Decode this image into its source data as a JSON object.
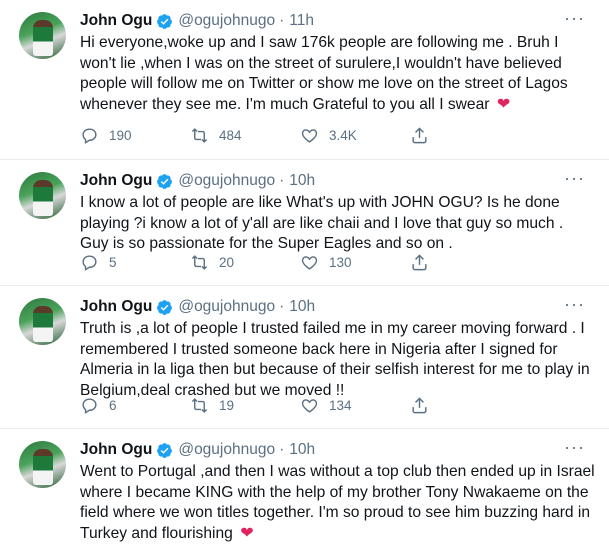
{
  "tweets": [
    {
      "author": "John Ogu",
      "handle": "@ogujohnugo",
      "separator": "·",
      "time": "11h",
      "text": "Hi everyone,woke up and I saw 176k people are following me . Bruh I won't lie ,when I was on the street of surulere,I wouldn't have believed people will follow me on Twitter or show me love on the street of Lagos whenever they see me. I'm much Grateful to you all I swear",
      "emoji": "❤",
      "replies": "190",
      "retweets": "484",
      "likes": "3.4K"
    },
    {
      "author": "John Ogu",
      "handle": "@ogujohnugo",
      "separator": "·",
      "time": "10h",
      "text": "I know a lot of people are like What's up with JOHN OGU? Is he done playing ?i know a lot of y'all are like chaii and I love that guy so much . Guy is so passionate for the Super Eagles and so on .",
      "emoji": "",
      "replies": "5",
      "retweets": "20",
      "likes": "130"
    },
    {
      "author": "John Ogu",
      "handle": "@ogujohnugo",
      "separator": "·",
      "time": "10h",
      "text": "Truth is ,a lot of people I trusted failed me in my career moving forward . I remembered I trusted someone back here in Nigeria after I signed for Almeria in la liga then but because of their selfish interest for me to play in Belgium,deal crashed but we moved !!",
      "emoji": "",
      "replies": "6",
      "retweets": "19",
      "likes": "134"
    },
    {
      "author": "John Ogu",
      "handle": "@ogujohnugo",
      "separator": "·",
      "time": "10h",
      "text": "Went to Portugal ,and then I was without a top club then ended up in Israel where I became KING with the help of my brother Tony Nwakaeme on the field where we won titles together. I'm so proud to see him buzzing hard in Turkey and flourishing",
      "emoji": "❤",
      "replies": "",
      "retweets": "",
      "likes": ""
    }
  ],
  "icons": {
    "verified": "verified-badge-icon",
    "more": "more-options-icon",
    "reply": "reply-icon",
    "retweet": "retweet-icon",
    "like": "like-icon",
    "share": "share-icon"
  },
  "colors": {
    "verified": "#1da1f2",
    "heart": "#e0245e",
    "muted": "#5b7083",
    "text": "#0f1419"
  }
}
